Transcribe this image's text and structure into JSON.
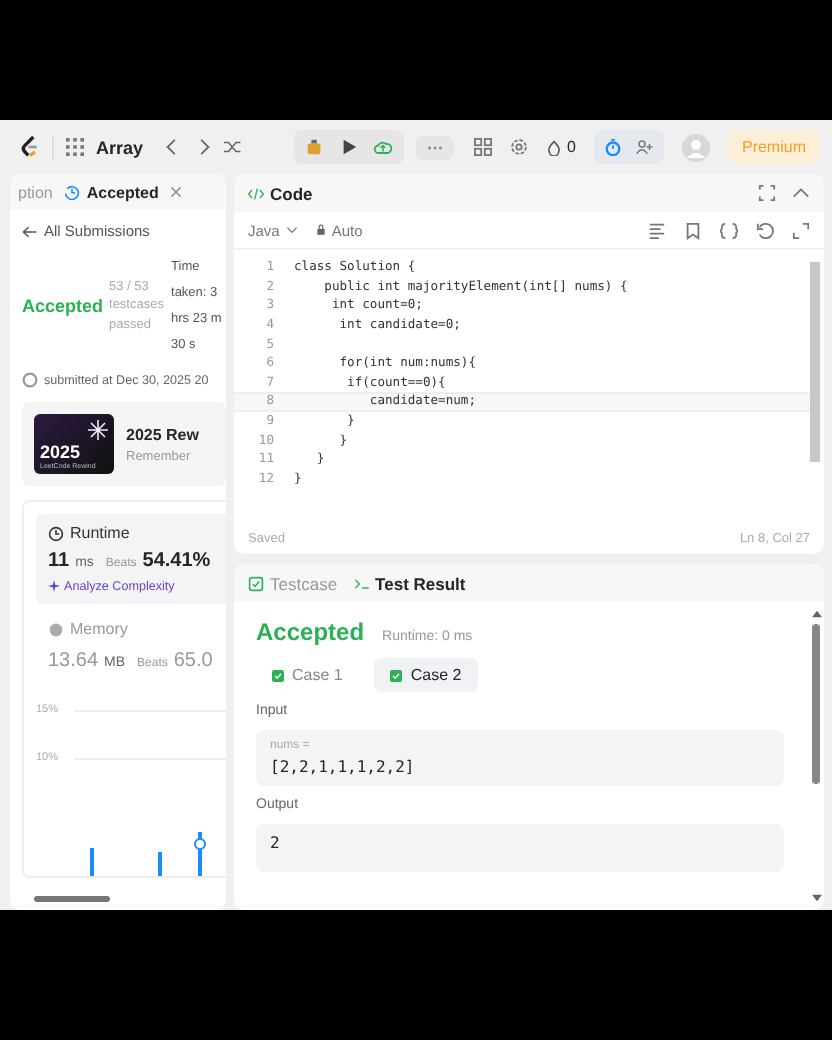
{
  "top_bar": {
    "problem_list": "Array",
    "streak": "0",
    "premium": "Premium"
  },
  "left_panel": {
    "tabs": [
      {
        "label": "ption",
        "selected": false
      },
      {
        "label": "Accepted",
        "selected": true
      }
    ],
    "back_link": "All Submissions",
    "status": "Accepted",
    "testcases": "53 / 53 testcases passed",
    "time_taken": [
      "Time",
      "taken: 3",
      "hrs 23 m",
      "30 s"
    ],
    "submitted": "submitted at Dec 30, 2025 20",
    "banner": {
      "badge_year": "2025",
      "badge_caption": "LeetCode Rewind",
      "title": "2025 Rew",
      "subtitle": "Remember"
    },
    "runtime": {
      "label": "Runtime",
      "value": "11",
      "unit": "ms",
      "beats_label": "Beats",
      "beats": "54.41%",
      "analyze": "Analyze Complexity"
    },
    "memory": {
      "label": "Memory",
      "value": "13.64",
      "unit": "MB",
      "beats_label": "Beats",
      "beats": "65.0"
    },
    "chart_axis_labels": [
      "15%",
      "10%"
    ]
  },
  "code_panel": {
    "title": "Code",
    "language": "Java",
    "mode": "Auto",
    "lines": [
      {
        "number": "1",
        "text": "class Solution {",
        "current": false
      },
      {
        "number": "2",
        "text": "    public int majorityElement(int[] nums) {",
        "current": false
      },
      {
        "number": "3",
        "text": "     int count=0;",
        "current": false
      },
      {
        "number": "4",
        "text": "      int candidate=0;",
        "current": false
      },
      {
        "number": "5",
        "current": false
      },
      {
        "number": "6",
        "text": "      for(int num:nums){",
        "current": false
      },
      {
        "number": "7",
        "text": "       if(count==0){",
        "current": false
      },
      {
        "number": "8",
        "text": "          candidate=num;",
        "current": true
      },
      {
        "number": "9",
        "text": "       }",
        "current": false
      },
      {
        "number": "10",
        "text": "      }",
        "current": false
      },
      {
        "number": "11",
        "text": "   }",
        "current": false
      },
      {
        "number": "12",
        "text": "}",
        "current": false
      }
    ],
    "status": "Saved",
    "cursor": "Ln 8, Col 27"
  },
  "result_panel": {
    "tabs": [
      {
        "label": "Testcase",
        "selected": false
      },
      {
        "label": "Test Result",
        "selected": true
      }
    ],
    "verdict": "Accepted",
    "runtime": "Runtime: 0 ms",
    "cases": [
      {
        "label": "Case 1",
        "selected": false
      },
      {
        "label": "Case 2",
        "selected": true
      }
    ],
    "input_label": "Input",
    "input_name": "nums =",
    "input_value": "[2,2,1,1,1,2,2]",
    "output_label": "Output",
    "output_value": "2"
  }
}
